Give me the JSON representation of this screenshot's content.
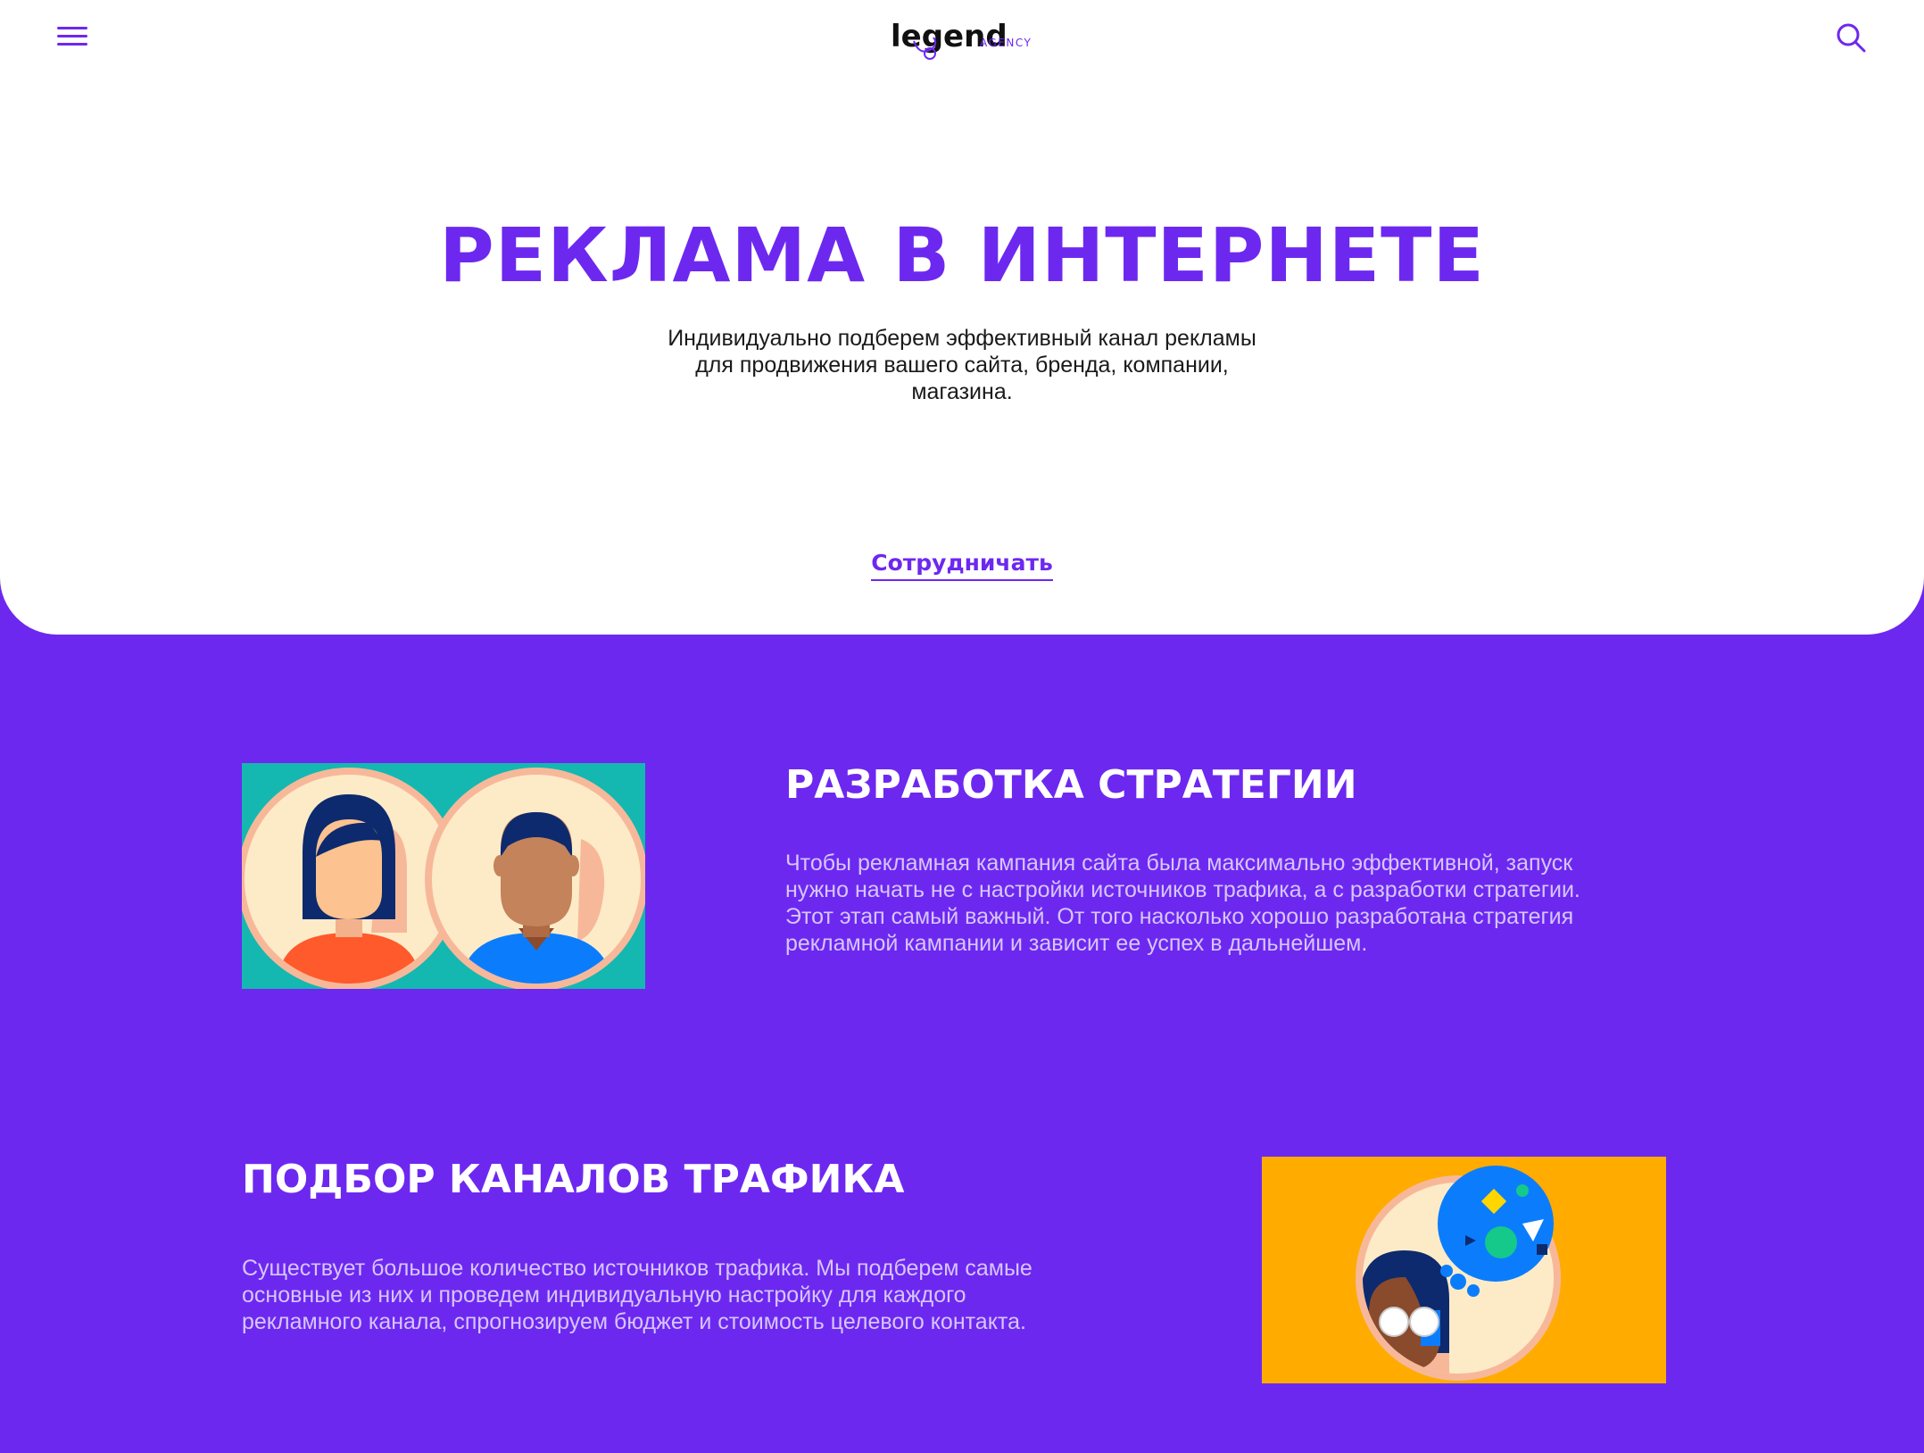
{
  "header": {
    "logo_text": "legend",
    "logo_sub": "AGENCY",
    "menu_icon": "hamburger-menu-icon",
    "search_icon": "search-icon"
  },
  "hero": {
    "title": "РЕКЛАМА В ИНТЕРНЕТЕ",
    "subtitle_lines": [
      "Индивидуально подберем эффективный канал рекламы",
      "для продвижения вашего сайта, бренда, компании,",
      "магазина."
    ],
    "cta_label": "Сотрудничать"
  },
  "sections": [
    {
      "title": "РАЗРАБОТКА СТРАТЕГИИ",
      "text_lines": [
        "Чтобы рекламная кампания сайта была максимально эффективной, запуск",
        "нужно начать не с настройки источников трафика, а с разработки стратегии.",
        "Этот этап самый важный. От того насколько хорошо разработана стратегия",
        "рекламной кампании и зависит ее успех в дальнейшем."
      ],
      "image": "two-people-avatars-illustration"
    },
    {
      "title": "ПОДБОР КАНАЛОВ ТРАФИКА",
      "text_lines": [
        "Существует большое количество источников трафика.  Мы подберем самые",
        "основные из них и проведем индивидуальную настройку для каждого",
        "рекламного канала, спрогнозируем бюджет и стоимость целевого контакта."
      ],
      "image": "person-thinking-illustration"
    }
  ],
  "colors": {
    "accent": "#6d28f0",
    "section_bg": "#6d28f0",
    "hero_bg": "#ffffff",
    "teal": "#14b8b0",
    "orange": "#ffab00"
  }
}
